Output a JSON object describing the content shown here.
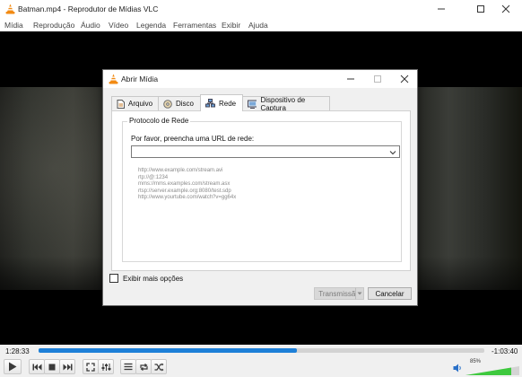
{
  "window": {
    "title": "Batman.mp4 - Reprodutor de Mídias VLC",
    "app_icon": "vlc-cone-icon",
    "controls": [
      "minimize-icon",
      "maximize-icon",
      "close-icon"
    ]
  },
  "menubar": {
    "items": [
      {
        "label": "Mídia",
        "mnemonic": "M"
      },
      {
        "label": "Reprodução",
        "mnemonic": "R"
      },
      {
        "label": "Áudio",
        "mnemonic": "Á"
      },
      {
        "label": "Vídeo",
        "mnemonic": "V"
      },
      {
        "label": "Legenda",
        "mnemonic": "L"
      },
      {
        "label": "Ferramentas",
        "mnemonic": "F"
      },
      {
        "label": "Exibir",
        "mnemonic": "E"
      },
      {
        "label": "Ajuda",
        "mnemonic": "A"
      }
    ]
  },
  "dialog": {
    "title": "Abrir Mídia",
    "tabs": [
      {
        "label": "Arquivo",
        "icon": "file-icon",
        "active": false
      },
      {
        "label": "Disco",
        "icon": "disc-icon",
        "active": false
      },
      {
        "label": "Rede",
        "icon": "network-icon",
        "active": true
      },
      {
        "label": "Dispositivo de Captura",
        "icon": "capture-device-icon",
        "active": false
      }
    ],
    "group_title": "Protocolo de Rede",
    "url_label": "Por favor, preencha uma URL de rede:",
    "url_value": "",
    "examples": [
      "http://www.example.com/stream.avi",
      "rtp://@:1234",
      "mms://mms.examples.com/stream.asx",
      "rtsp://server.example.org:8080/test.sdp",
      "http://www.yourtube.com/watch?v=gg64x"
    ],
    "show_more_label": "Exibir mais opções",
    "show_more_checked": false,
    "stream_button": "Transmissão",
    "cancel_button": "Cancelar"
  },
  "player": {
    "elapsed": "1:28:33",
    "remaining": "-1:03:40",
    "progress_fraction": 0.58,
    "volume_label": "85%",
    "volume_fraction": 0.85,
    "accent_color": "#1e80d8",
    "volume_color": "#3ec93e"
  }
}
